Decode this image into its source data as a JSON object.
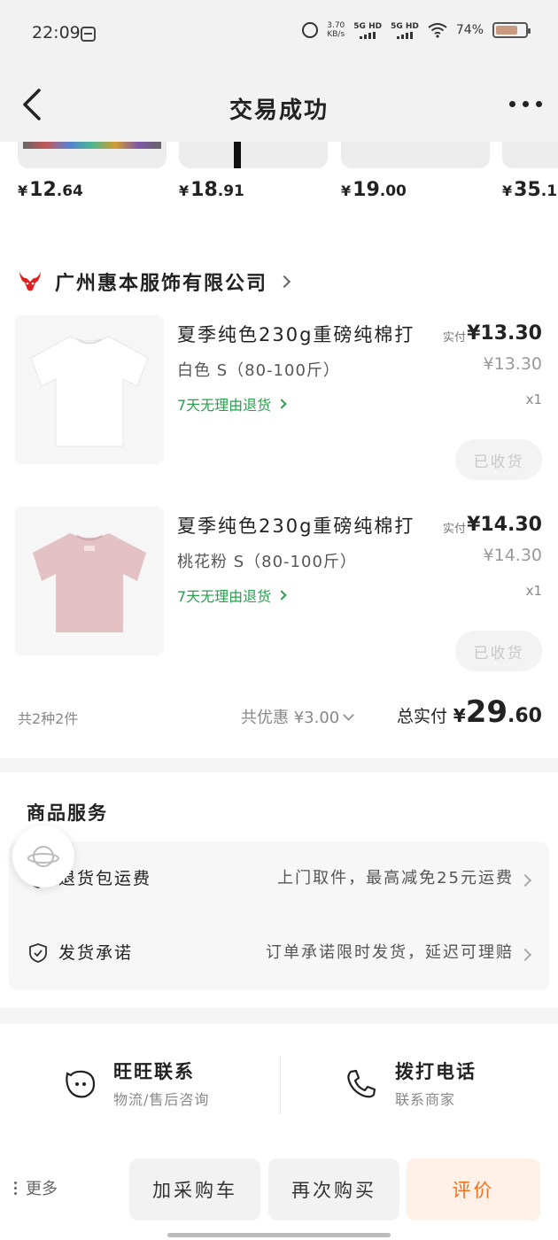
{
  "status_bar": {
    "time": "22:09",
    "net_speed": "3.70",
    "net_unit": "KB/s",
    "sim1": "5G HD",
    "sim2": "5G HD",
    "battery": "74%"
  },
  "nav": {
    "title": "交易成功"
  },
  "recommendations": [
    {
      "yen": "¥",
      "int": "12",
      "dec": ".64"
    },
    {
      "yen": "¥",
      "int": "18",
      "dec": ".91"
    },
    {
      "yen": "¥",
      "int": "19",
      "dec": ".00"
    },
    {
      "yen": "¥",
      "int": "35",
      "dec": ".1"
    }
  ],
  "shop": {
    "name": "广州惠本服饰有限公司",
    "items": [
      {
        "title": "夏季纯色230g重磅纯棉打",
        "spec": "白色 S（80-100斤）",
        "return_policy": "7天无理由退货",
        "paid_label": "实付",
        "paid_price": "¥13.30",
        "original_price": "¥13.30",
        "quantity": "x1",
        "status_button": "已收货",
        "color": "#ffffff"
      },
      {
        "title": "夏季纯色230g重磅纯棉打",
        "spec": "桃花粉 S（80-100斤）",
        "return_policy": "7天无理由退货",
        "paid_label": "实付",
        "paid_price": "¥14.30",
        "original_price": "¥14.30",
        "quantity": "x1",
        "status_button": "已收货",
        "color": "#e4c1c4"
      }
    ],
    "summary": {
      "count": "共2种2件",
      "discount": "共优惠 ¥3.00",
      "total_label": "总实付",
      "total_yen": "¥",
      "total_int": "29",
      "total_dec": ".60"
    }
  },
  "services": {
    "title": "商品服务",
    "rows": [
      {
        "label": "退货包运费",
        "desc": "上门取件，最高减免25元运费"
      },
      {
        "label": "发货承诺",
        "desc": "订单承诺限时发货，延迟可理赔"
      }
    ]
  },
  "contacts": [
    {
      "title": "旺旺联系",
      "subtitle": "物流/售后咨询"
    },
    {
      "title": "拨打电话",
      "subtitle": "联系商家"
    }
  ],
  "actions": {
    "more": "更多",
    "add_cart": "加采购车",
    "buy_again": "再次购买",
    "review": "评价"
  },
  "colors": {
    "accent_green": "#2a9d4e",
    "accent_orange": "#f07020",
    "brand_red": "#e02020"
  }
}
